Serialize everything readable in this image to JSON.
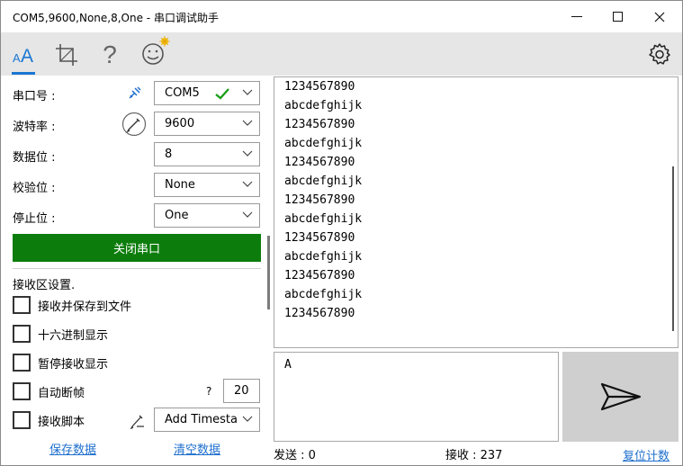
{
  "window": {
    "title": "COM5,9600,None,8,One - 串口调试助手",
    "minimize": "—",
    "maximize": "☐",
    "close": "✕"
  },
  "toolbar": {
    "tabs": [
      {
        "name": "font",
        "label": "ᴀA",
        "active": true
      },
      {
        "name": "crop",
        "icon": "crop-icon"
      },
      {
        "name": "help",
        "label": "?"
      },
      {
        "name": "emoji",
        "icon": "smiley-icon"
      }
    ],
    "accent": "#1977d3"
  },
  "settings": {
    "port_label": "串口号 :",
    "port_value": "COM5",
    "baud_label": "波特率 :",
    "baud_value": "9600",
    "databits_label": "数据位 :",
    "databits_value": "8",
    "parity_label": "校验位 :",
    "parity_value": "None",
    "stopbits_label": "停止位 :",
    "stopbits_value": "One",
    "close_port_button": "关闭串口",
    "button_color": "#0c7d0c"
  },
  "receive_settings": {
    "heading": "接收区设置.",
    "save_to_file": "接收并保存到文件",
    "hex_display": "十六进制显示",
    "pause_display": "暂停接收显示",
    "auto_frame": "自动断帧",
    "auto_frame_help": "?",
    "auto_frame_value": "20",
    "receive_script": "接收脚本",
    "script_value": "Add Timesta",
    "save_data_link": "保存数据",
    "clear_data_link": "清空数据"
  },
  "receive_lines": [
    "1234567890",
    "abcdefghijk",
    "1234567890",
    "abcdefghijk",
    "1234567890",
    "abcdefghijk",
    "1234567890",
    "abcdefghijk",
    "1234567890",
    "abcdefghijk",
    "1234567890",
    "abcdefghijk",
    "1234567890"
  ],
  "send_text": "A",
  "status": {
    "sent": "发送 : 0",
    "received": "接收 : 237",
    "reset_count": "复位计数"
  }
}
